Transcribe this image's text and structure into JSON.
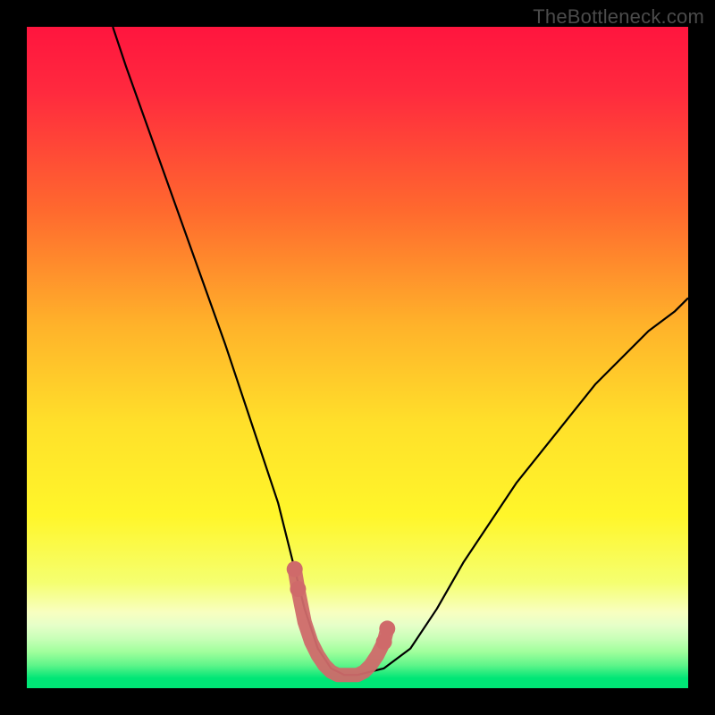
{
  "attribution": "TheBottleneck.com",
  "chart_data": {
    "type": "line",
    "title": "",
    "xlabel": "",
    "ylabel": "",
    "xlim": [
      0,
      100
    ],
    "ylim": [
      0,
      100
    ],
    "series": [
      {
        "name": "main-curve",
        "x": [
          13,
          15,
          20,
          25,
          30,
          34,
          38,
          40,
          42,
          44,
          46,
          48,
          50,
          54,
          58,
          62,
          66,
          70,
          74,
          78,
          82,
          86,
          90,
          94,
          98,
          100
        ],
        "y": [
          100,
          94,
          80,
          66,
          52,
          40,
          28,
          20,
          12,
          6,
          3,
          2,
          2,
          3,
          6,
          12,
          19,
          25,
          31,
          36,
          41,
          46,
          50,
          54,
          57,
          59
        ]
      },
      {
        "name": "highlight-bottom",
        "x": [
          40.5,
          41,
          42,
          43,
          44,
          45,
          46,
          47,
          48,
          49,
          50,
          51,
          52,
          53,
          54,
          54.5
        ],
        "y": [
          18,
          15,
          10,
          7,
          5,
          3.5,
          2.5,
          2,
          2,
          2,
          2,
          2.5,
          3.5,
          5,
          7,
          9
        ]
      }
    ],
    "background_gradient": {
      "top": "#ff153e",
      "mid_upper": "#ff8a2a",
      "mid": "#ffe92a",
      "mid_lower": "#f3ff8a",
      "band": "#d8ffb0",
      "bottom": "#00e676"
    },
    "highlight_color": "#cf6a6a"
  }
}
